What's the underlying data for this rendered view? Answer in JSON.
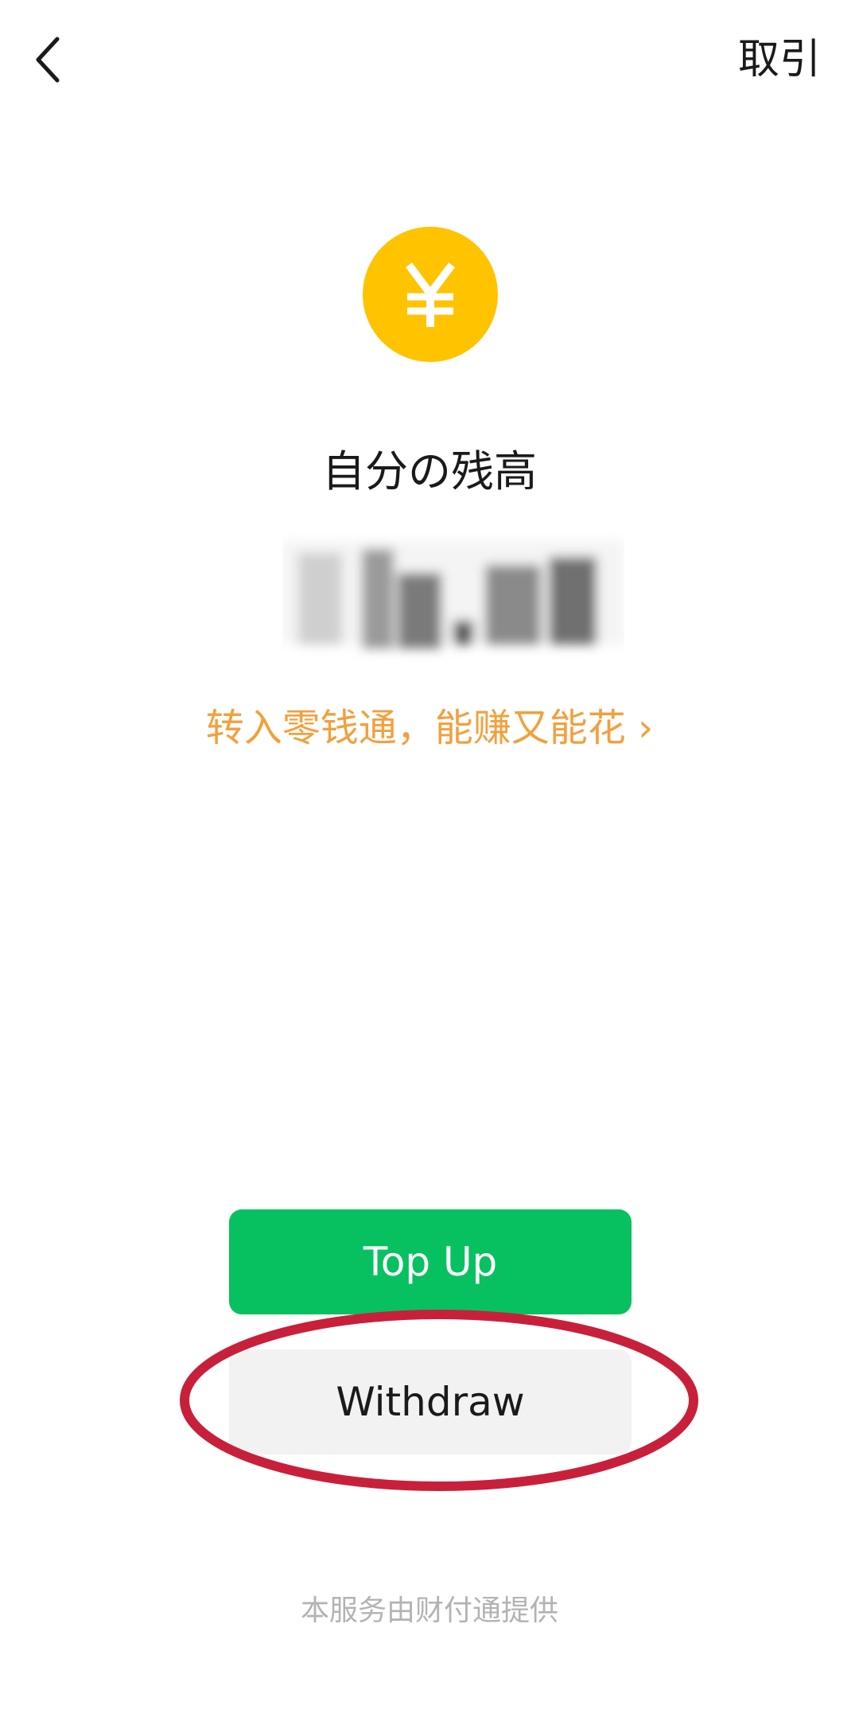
{
  "nav": {
    "back_icon": "chevron-left-icon",
    "transactions_label": "取引"
  },
  "balance": {
    "icon": "yuan-icon",
    "icon_glyph": "¥",
    "icon_color": "#ffc300",
    "label": "自分の残高",
    "promo_text": "转入零钱通，能赚又能花 ›",
    "promo_color": "#f2a03d"
  },
  "actions": {
    "topup_label": "Top Up",
    "topup_color": "#07c160",
    "withdraw_label": "Withdraw",
    "withdraw_color": "#f2f2f2",
    "highlight_color": "#c8203a"
  },
  "footer": {
    "provider_text": "本服务由财付通提供"
  }
}
